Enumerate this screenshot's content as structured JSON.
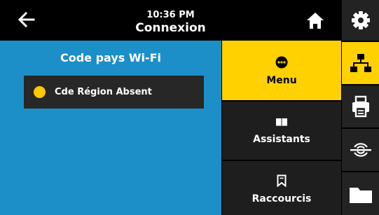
{
  "header": {
    "back_icon": "arrow-left-icon",
    "time": "10:36 PM",
    "title": "Connexion",
    "home_icon": "home-icon"
  },
  "panel": {
    "title": "Code pays Wi-Fi",
    "status": {
      "icon": "status-dot-icon",
      "color": "#ffc800",
      "label": "Cde Région Absent"
    },
    "background_color": "#1c8fc8"
  },
  "menu": {
    "items": [
      {
        "label": "Menu",
        "icon": "menu-dots-icon",
        "active": true
      },
      {
        "label": "Assistants",
        "icon": "book-icon",
        "active": false
      },
      {
        "label": "Raccourcis",
        "icon": "bookmark-icon",
        "active": false
      }
    ],
    "active_color": "#ffd100"
  },
  "rail": {
    "items": [
      {
        "icon": "gear-icon",
        "active": false
      },
      {
        "icon": "network-icon",
        "active": true
      },
      {
        "icon": "printer-icon",
        "active": false
      },
      {
        "icon": "rfid-icon",
        "active": false
      },
      {
        "icon": "folder-icon",
        "active": false
      }
    ]
  }
}
